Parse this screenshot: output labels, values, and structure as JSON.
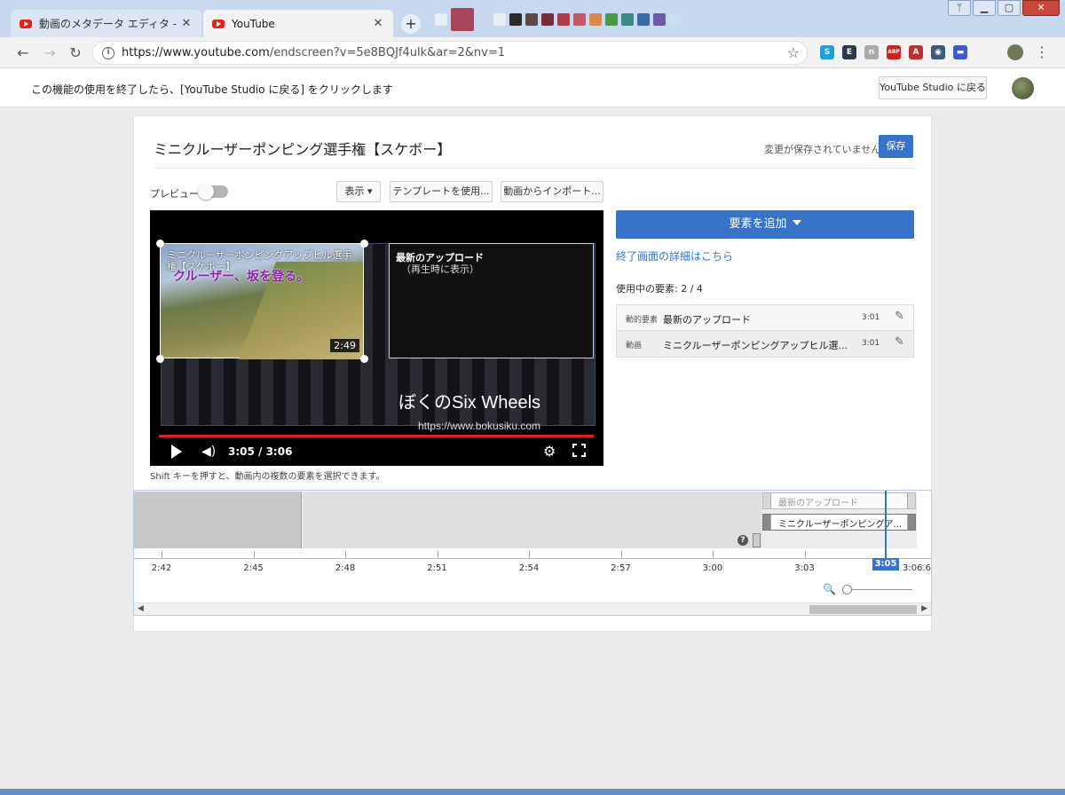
{
  "browser": {
    "tabs": [
      {
        "title": "動画のメタデータ エディタ - YouTube Studio",
        "close": "✕"
      },
      {
        "title": "YouTube",
        "close": "✕"
      }
    ],
    "new_tab": "+",
    "url_host": "https://www.youtube.com",
    "url_path": "/endscreen?v=5e8BQJf4ulk&ar=2&nv=1",
    "swatch_colors": [
      "#e8eef6",
      "#a8455a",
      "#c9d7ea",
      "#e8eef6",
      "#2b2b2b",
      "#5a4a4a",
      "#7a2a3a",
      "#b03a4a",
      "#c05a6a",
      "#d88a4a",
      "#4a9a4a",
      "#3a8a8a",
      "#3a6aa8",
      "#6a5aa8",
      "#c7e0f0"
    ],
    "extensions": [
      {
        "name": "skype-icon",
        "color": "#1ea0e0",
        "glyph": "S"
      },
      {
        "name": "evernote-icon",
        "color": "#2a3a4a",
        "glyph": "E"
      },
      {
        "name": "ext-grey-icon",
        "color": "#aaaaaa",
        "glyph": "n"
      },
      {
        "name": "adblock-icon",
        "color": "#d02020",
        "glyph": "ABP"
      },
      {
        "name": "pdf-icon",
        "color": "#c03030",
        "glyph": "A"
      },
      {
        "name": "vpn-icon",
        "color": "#3a5a7a",
        "glyph": "◉"
      },
      {
        "name": "chat-icon",
        "color": "#3a5ad0",
        "glyph": "▬"
      }
    ]
  },
  "notice": {
    "text": "この機能の使用を終了したら、[YouTube Studio に戻る] をクリックします",
    "studio_button": "YouTube Studio に戻る"
  },
  "editor": {
    "video_title": "ミニクルーザーポンピング選手権【スケボー】",
    "unsaved": "変更が保存されていません",
    "save": "保存",
    "preview_label": "プレビュー",
    "buttons": {
      "display": "表示 ▾",
      "template": "テンプレートを使用...",
      "import": "動画からインポート..."
    },
    "shift_hint": "Shift キーを押すと、動画内の複数の要素を選択できます。"
  },
  "player": {
    "video_element_title": "ミニクルーザーポンピングアップヒル選手権【スケボー】",
    "video_overlay_text": "クルーザー、坂を登る。",
    "video_duration": "2:49",
    "latest_title": "最新のアップロード",
    "latest_sub": "（再生時に表示）",
    "watermark": "ぼくのSix Wheels",
    "watermark_url": "https://www.bokusiku.com",
    "time": "3:05 / 3:06",
    "volume_glyph": "◀)",
    "settings_glyph": "⚙"
  },
  "side": {
    "add_element": "要素を追加",
    "detail_link": "終了画面の詳細はこちら",
    "usage": "使用中の要素: 2 / 4",
    "elements": [
      {
        "type": "動的要素",
        "name": "最新のアップロード",
        "time": "3:01"
      },
      {
        "type": "動画",
        "name": "ミニクルーザーポンピングアップヒル選...",
        "time": "3:01"
      }
    ],
    "pencil_glyph": "✎"
  },
  "timeline": {
    "tracks": [
      {
        "label": "最新のアップロード"
      },
      {
        "label": "ミニクルーザーポンピングア..."
      }
    ],
    "help": "?",
    "ticks": [
      "2:42",
      "2:45",
      "2:48",
      "2:51",
      "2:54",
      "2:57",
      "3:00",
      "3:03"
    ],
    "playhead": "3:05",
    "end": "3:06.6",
    "zoom_glyph": "🔍"
  }
}
